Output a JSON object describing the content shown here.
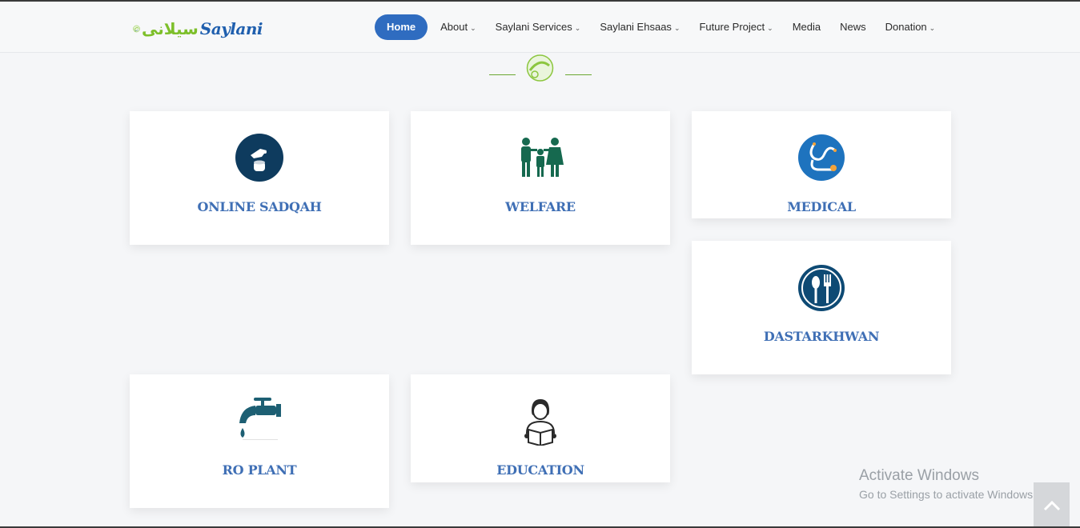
{
  "header": {
    "logo_text": "Saylani",
    "logo_urdu": "سیلانی",
    "nav": [
      {
        "label": "Home",
        "active": true,
        "dropdown": false
      },
      {
        "label": "About",
        "active": false,
        "dropdown": true
      },
      {
        "label": "Saylani Services",
        "active": false,
        "dropdown": true
      },
      {
        "label": "Saylani Ehsaas",
        "active": false,
        "dropdown": true
      },
      {
        "label": "Future Project",
        "active": false,
        "dropdown": true
      },
      {
        "label": "Media",
        "active": false,
        "dropdown": false
      },
      {
        "label": "News",
        "active": false,
        "dropdown": false
      },
      {
        "label": "Donation",
        "active": false,
        "dropdown": true
      }
    ]
  },
  "cards": [
    {
      "title": "ONLINE SADQAH",
      "icon": "sadqah-icon"
    },
    {
      "title": "WELFARE",
      "icon": "family-icon"
    },
    {
      "title": "MEDICAL",
      "icon": "stethoscope-icon"
    },
    {
      "title": "DASTARKHWAN",
      "icon": "spoon-fork-icon"
    },
    {
      "title": "RO PLANT",
      "icon": "water-tap-icon"
    },
    {
      "title": "EDUCATION",
      "icon": "student-reading-icon"
    }
  ],
  "watermark": {
    "line1": "Activate Windows",
    "line2": "Go to Settings to activate Windows."
  },
  "colors": {
    "accent": "#2f6cc0",
    "card_title": "#3f6fb5",
    "logo_green": "#7dbf2a"
  }
}
